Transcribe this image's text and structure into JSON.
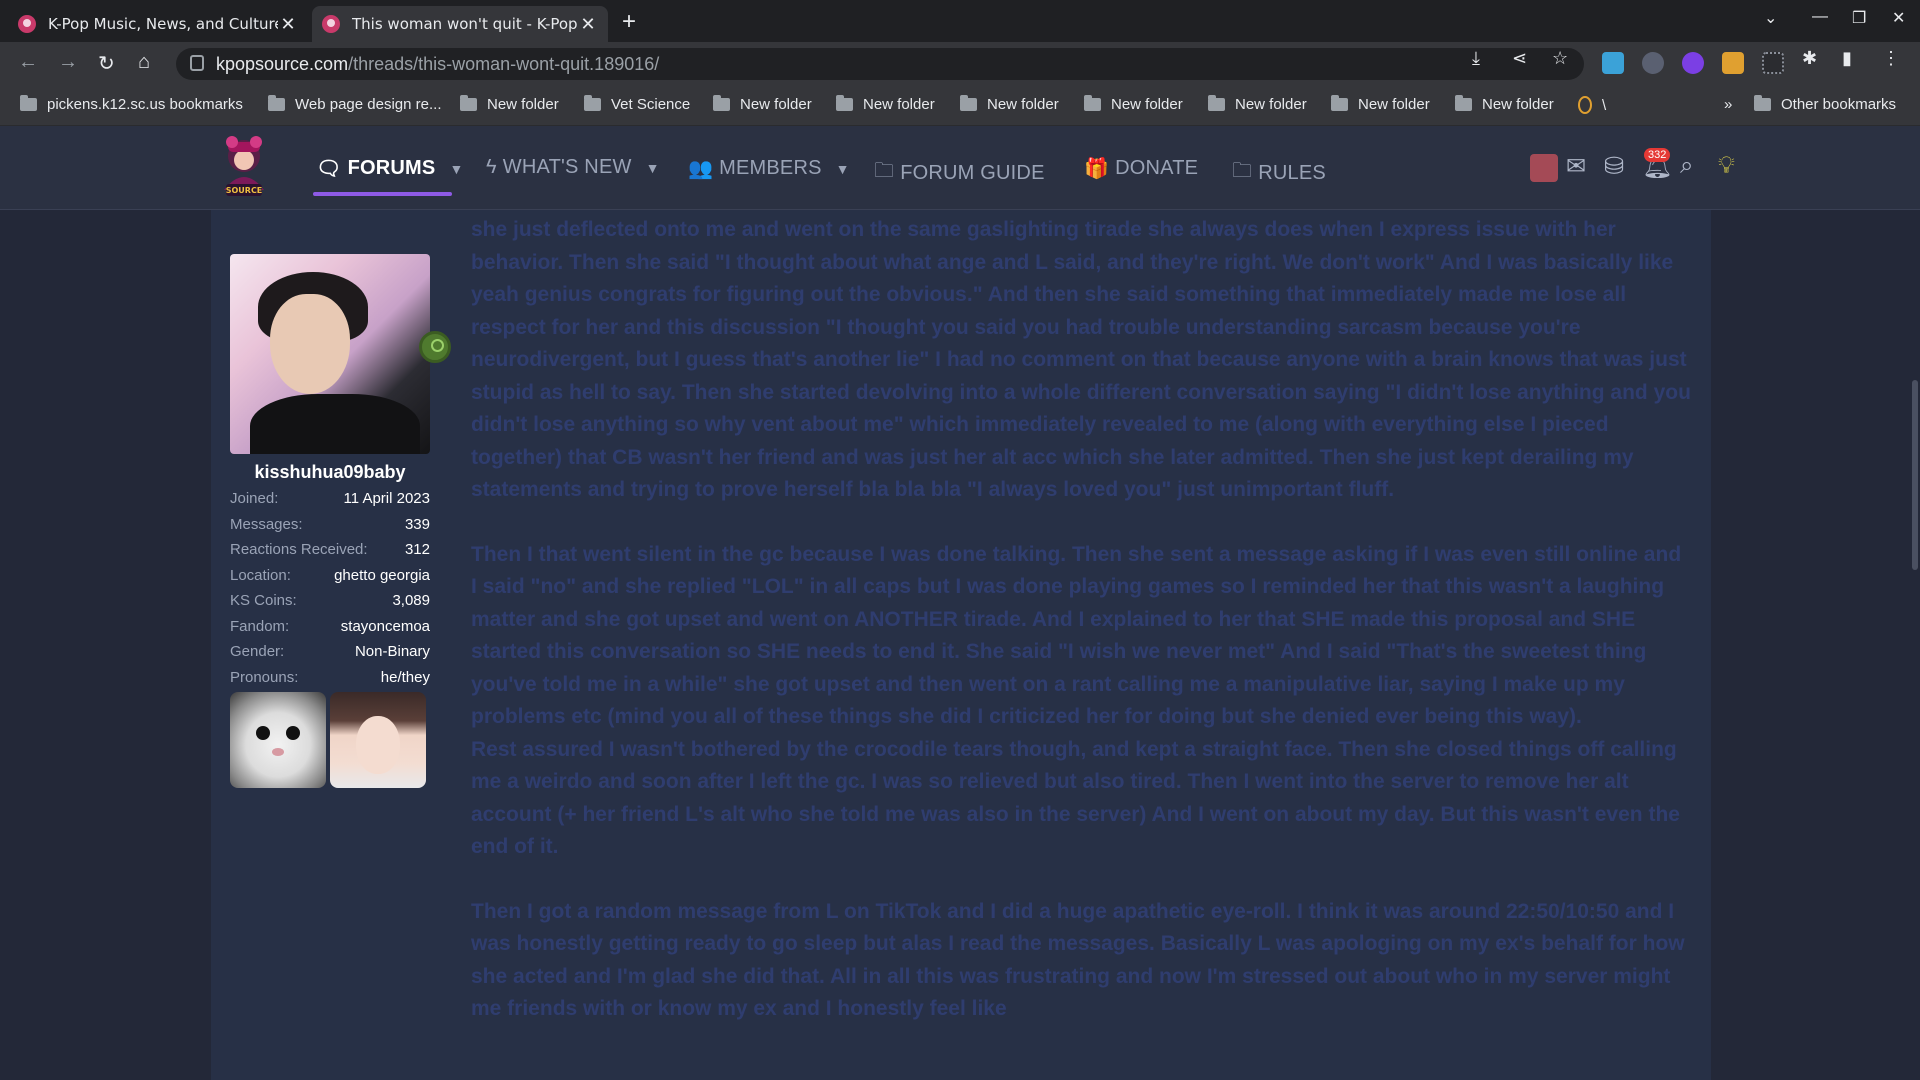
{
  "browser": {
    "tabs": [
      {
        "title": "K-Pop Music, News, and Culture",
        "active": false
      },
      {
        "title": "This woman won't quit - K-Pop M",
        "active": true
      }
    ],
    "address": {
      "host": "kpopsource.com",
      "path": "/threads/this-woman-wont-quit.189016/"
    },
    "bookmarks": [
      {
        "label": "pickens.k12.sc.us bookmarks"
      },
      {
        "label": "Web page design re..."
      },
      {
        "label": "New folder"
      },
      {
        "label": "Vet Science"
      },
      {
        "label": "New folder"
      },
      {
        "label": "New folder"
      },
      {
        "label": "New folder"
      },
      {
        "label": "New folder"
      },
      {
        "label": "New folder"
      },
      {
        "label": "New folder"
      },
      {
        "label": "New folder"
      },
      {
        "label": "\\"
      },
      {
        "label": "Other bookmarks"
      }
    ],
    "more_bookmarks": "»"
  },
  "site_nav": {
    "items": [
      {
        "label": "FORUMS",
        "icon": "chat-bubbles-icon",
        "active": true,
        "caret": true
      },
      {
        "label": "WHAT'S NEW",
        "icon": "bolt-icon",
        "active": false,
        "caret": true
      },
      {
        "label": "MEMBERS",
        "icon": "users-icon",
        "active": false,
        "caret": true
      },
      {
        "label": "FORUM GUIDE",
        "icon": "folder-icon",
        "active": false,
        "caret": false
      },
      {
        "label": "DONATE",
        "icon": "gift-icon",
        "active": false,
        "caret": false
      },
      {
        "label": "RULES",
        "icon": "folder-icon",
        "active": false,
        "caret": false
      }
    ],
    "alerts_count": "332",
    "accent": "#8e5ae6"
  },
  "user": {
    "name": "kisshuhua09baby",
    "stats": [
      {
        "k": "Joined:",
        "v": "11 April 2023"
      },
      {
        "k": "Messages:",
        "v": "339"
      },
      {
        "k": "Reactions Received:",
        "v": "312"
      },
      {
        "k": "Location:",
        "v": "ghetto georgia"
      },
      {
        "k": "KS Coins:",
        "v": "3,089"
      },
      {
        "k": "Fandom:",
        "v": "stayoncemoa"
      },
      {
        "k": "Gender:",
        "v": "Non-Binary"
      },
      {
        "k": "Pronouns:",
        "v": "he/they"
      }
    ]
  },
  "post": {
    "paragraphs": [
      "she just deflected onto me and went on the same gaslighting tirade she always does when I express issue with her behavior. Then she said \"I thought about what ange and L said, and they're right. We don't work\" And I was basically like yeah genius congrats for figuring out the obvious.\" And then she said something that immediately made me lose all respect for her and this discussion \"I thought you said you had trouble understanding sarcasm because you're neurodivergent, but I guess that's another lie\" I had no comment on that because anyone with a brain knows that was just stupid as hell to say. Then she started devolving into a whole different conversation saying \"I didn't lose anything and you didn't lose anything so why vent about me\" which immediately revealed to me (along with everything else I pieced together) that CB wasn't her friend and was just her alt acc which she later admitted. Then she just kept derailing my statements and trying to prove herself bla bla bla \"I always loved you\" just unimportant fluff.",
      "Then I that went silent in the gc because I was done talking. Then she sent a message asking if I was even still online and I said \"no\" and she replied \"LOL\" in all caps but I was done playing games so I reminded her that this wasn't a laughing matter and she got upset and went on ANOTHER tirade. And I explained to her that SHE made this proposal and SHE started this conversation so SHE needs to end it. She said \"I wish we never met\" And I said \"That's the sweetest thing you've told me in a while\" she got upset and then went on a rant calling me a manipulative liar, saying I make up my problems etc (mind you all of these things she did I criticized her for doing but she denied ever being this way).\nRest assured I wasn't bothered by the crocodile tears though, and kept a straight face. Then she closed things off calling me a weirdo and soon after I left the gc. I was so relieved but also tired. Then I went into the server to remove her alt account (+ her friend L's alt who she told me was also in the server) And I went on about my day. But this wasn't even the end of it.",
      "Then I got a random message from L on TikTok and I did a huge apathetic eye-roll. I think it was around 22:50/10:50 and I was honestly getting ready to go sleep but alas I read the messages. Basically L was apologing on my ex's behalf for how she acted and I'm glad she did that. All in all this was frustrating and now I'm stressed out about who in my server might me friends with or know my ex and I honestly feel like"
    ]
  }
}
